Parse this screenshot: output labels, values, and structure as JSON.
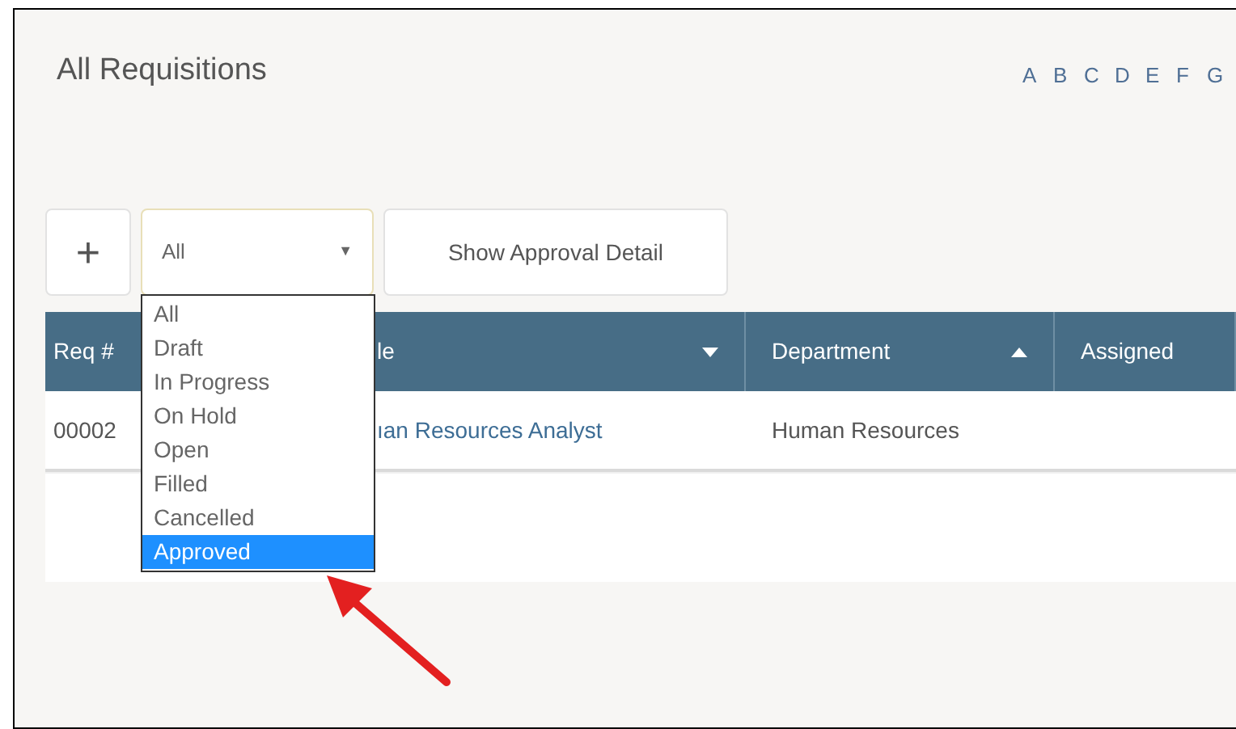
{
  "title": "All Requisitions",
  "letters": [
    "A",
    "B",
    "C",
    "D",
    "E",
    "F",
    "G"
  ],
  "toolbar": {
    "add_button": "+",
    "filter": {
      "value": "All",
      "caret": "▼"
    },
    "approval_button": "Show Approval Detail"
  },
  "filter_menu": [
    {
      "label": "All",
      "selected": false
    },
    {
      "label": "Draft",
      "selected": false
    },
    {
      "label": "In Progress",
      "selected": false
    },
    {
      "label": "On Hold",
      "selected": false
    },
    {
      "label": "Open",
      "selected": false
    },
    {
      "label": "Filled",
      "selected": false
    },
    {
      "label": "Cancelled",
      "selected": false
    },
    {
      "label": "Approved",
      "selected": true
    }
  ],
  "table": {
    "columns": [
      {
        "label": "Req #",
        "kind": "plain"
      },
      {
        "label": "le",
        "kind": "sortdown"
      },
      {
        "label": "Department",
        "kind": "sortup"
      },
      {
        "label": "Assigned",
        "kind": "plain"
      }
    ],
    "rows": [
      [
        "00002",
        "ıan Resources Analyst",
        "Human Resources",
        ""
      ]
    ]
  }
}
